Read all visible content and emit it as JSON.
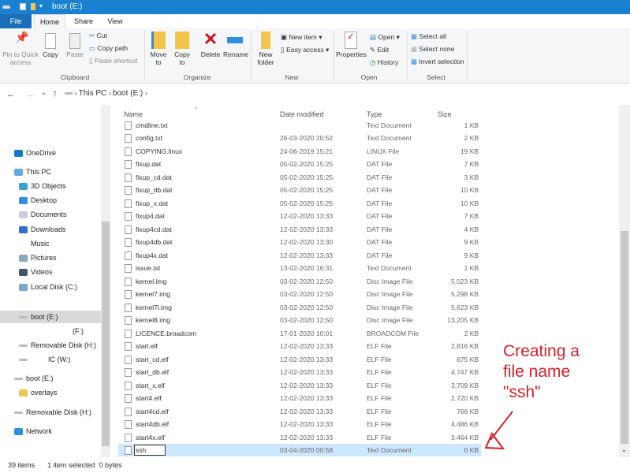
{
  "window": {
    "title": "boot (E:)"
  },
  "tabs": [
    {
      "label": "File"
    },
    {
      "label": "Home"
    },
    {
      "label": "Share"
    },
    {
      "label": "View"
    }
  ],
  "ribbon": {
    "clipboard": {
      "group": "Clipboard",
      "pin": "Pin to Quick access",
      "copy": "Copy",
      "paste": "Paste",
      "cut": "Cut",
      "copy_path": "Copy path",
      "paste_shortcut": "Paste shortcut"
    },
    "organize": {
      "group": "Organize",
      "move_to": "Move to",
      "copy_to": "Copy to",
      "delete": "Delete",
      "rename": "Rename"
    },
    "new": {
      "group": "New",
      "new_folder": "New folder",
      "new_item": "New item",
      "easy_access": "Easy access"
    },
    "open": {
      "group": "Open",
      "properties": "Properties",
      "open": "Open",
      "edit": "Edit",
      "history": "History"
    },
    "select": {
      "group": "Select",
      "select_all": "Select all",
      "select_none": "Select none",
      "invert": "Invert selection"
    }
  },
  "breadcrumb": [
    {
      "label": "This PC"
    },
    {
      "label": "boot (E:)"
    }
  ],
  "sidebar": {
    "items": [
      {
        "label": "OneDrive",
        "icon": "cloud-icon"
      },
      {
        "label": "This PC",
        "icon": "computer-icon"
      },
      {
        "label": "3D Objects",
        "icon": "cube-icon"
      },
      {
        "label": "Desktop",
        "icon": "desktop-icon"
      },
      {
        "label": "Documents",
        "icon": "document-icon"
      },
      {
        "label": "Downloads",
        "icon": "download-icon"
      },
      {
        "label": "Music",
        "icon": "music-icon"
      },
      {
        "label": "Pictures",
        "icon": "picture-icon"
      },
      {
        "label": "Videos",
        "icon": "video-icon"
      },
      {
        "label": "Local Disk (C:)",
        "icon": "disk-icon"
      },
      {
        "label": "boot (E:)",
        "icon": "drive-icon"
      },
      {
        "label": "(F:)",
        "icon": ""
      },
      {
        "label": "Removable Disk (H:)",
        "icon": "drive-icon"
      },
      {
        "label": "IC (W:)",
        "icon": "drive-icon"
      },
      {
        "label": "boot (E:)",
        "icon": "drive-icon"
      },
      {
        "label": "overlays",
        "icon": "folder-icon"
      },
      {
        "label": "Removable Disk (H:)",
        "icon": "drive-icon"
      },
      {
        "label": "Network",
        "icon": "network-icon"
      }
    ]
  },
  "columns": {
    "name": "Name",
    "date": "Date modified",
    "type": "Type",
    "size": "Size"
  },
  "files": [
    {
      "name": "cmdline.txt",
      "date": "",
      "type": "Text Document",
      "size": "1 KB"
    },
    {
      "name": "config.txt",
      "date": "26-03-2020 20:52",
      "type": "Text Document",
      "size": "2 KB"
    },
    {
      "name": "COPYING.linux",
      "date": "24-06-2019 15:21",
      "type": "LINUX File",
      "size": "19 KB"
    },
    {
      "name": "fixup.dat",
      "date": "05-02-2020 15:25",
      "type": "DAT File",
      "size": "7 KB"
    },
    {
      "name": "fixup_cd.dat",
      "date": "05-02-2020 15:25",
      "type": "DAT File",
      "size": "3 KB"
    },
    {
      "name": "fixup_db.dat",
      "date": "05-02-2020 15:25",
      "type": "DAT File",
      "size": "10 KB"
    },
    {
      "name": "fixup_x.dat",
      "date": "05-02-2020 15:25",
      "type": "DAT File",
      "size": "10 KB"
    },
    {
      "name": "fixup4.dat",
      "date": "12-02-2020 13:33",
      "type": "DAT File",
      "size": "7 KB"
    },
    {
      "name": "fixup4cd.dat",
      "date": "12-02-2020 13:33",
      "type": "DAT File",
      "size": "4 KB"
    },
    {
      "name": "fixup4db.dat",
      "date": "12-02-2020 13:30",
      "type": "DAT File",
      "size": "9 KB"
    },
    {
      "name": "fixup4x.dat",
      "date": "12-02-2020 13:33",
      "type": "DAT File",
      "size": "9 KB"
    },
    {
      "name": "issue.txt",
      "date": "13-02-2020 16:31",
      "type": "Text Document",
      "size": "1 KB"
    },
    {
      "name": "kernel.img",
      "date": "03-02-2020 12:50",
      "type": "Disc Image File",
      "size": "5,023 KB"
    },
    {
      "name": "kernel7.img",
      "date": "03-02-2020 12:50",
      "type": "Disc Image File",
      "size": "5,298 KB"
    },
    {
      "name": "kernel7l.img",
      "date": "03-02-2020 12:50",
      "type": "Disc Image File",
      "size": "5,623 KB"
    },
    {
      "name": "kernel8.img",
      "date": "03-02-2020 12:50",
      "type": "Disc Image File",
      "size": "13,205 KB"
    },
    {
      "name": "LICENCE.broadcom",
      "date": "17-01-2020 10:01",
      "type": "BROADCOM File",
      "size": "2 KB"
    },
    {
      "name": "start.elf",
      "date": "12-02-2020 13:33",
      "type": "ELF File",
      "size": "2,816 KB"
    },
    {
      "name": "start_cd.elf",
      "date": "12-02-2020 13:33",
      "type": "ELF File",
      "size": "675 KB"
    },
    {
      "name": "start_db.elf",
      "date": "12-02-2020 13:33",
      "type": "ELF File",
      "size": "4,747 KB"
    },
    {
      "name": "start_x.elf",
      "date": "12-02-2020 13:33",
      "type": "ELF File",
      "size": "3,709 KB"
    },
    {
      "name": "start4.elf",
      "date": "12-02-2020 13:33",
      "type": "ELF File",
      "size": "2,720 KB"
    },
    {
      "name": "start4cd.elf",
      "date": "12-02-2020 13:33",
      "type": "ELF File",
      "size": "766 KB"
    },
    {
      "name": "start4db.elf",
      "date": "12-02-2020 13:33",
      "type": "ELF File",
      "size": "4,486 KB"
    },
    {
      "name": "start4x.elf",
      "date": "12-02-2020 13:33",
      "type": "ELF File",
      "size": "3,464 KB"
    },
    {
      "name": "ssh",
      "date": "03-04-2020 00:58",
      "type": "Text Document",
      "size": "0 KB",
      "selected": true,
      "renaming": true
    }
  ],
  "status": {
    "count": "39 items",
    "selected": "1 item selected  0 bytes"
  },
  "annotation": {
    "lines": [
      "Creating a",
      "file name",
      "\"ssh\""
    ],
    "color": "#d8202a"
  },
  "colors": {
    "accent": "#1a80d0",
    "selection": "#cce8ff"
  }
}
